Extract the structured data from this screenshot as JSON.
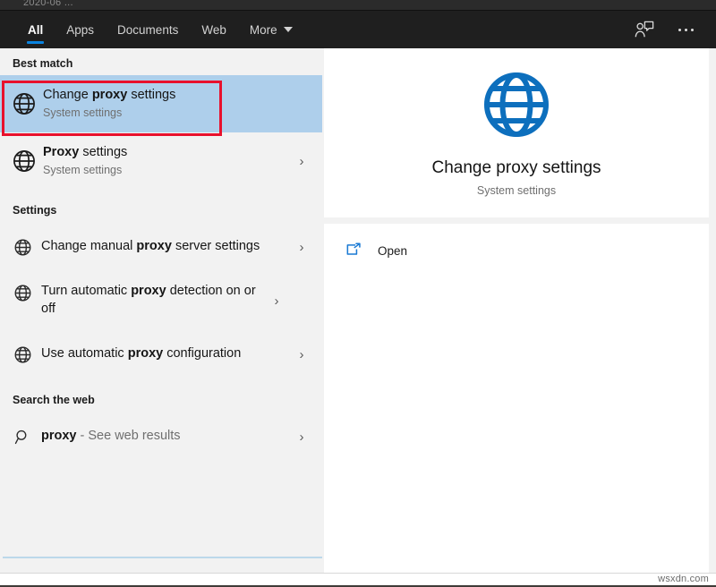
{
  "window": {
    "partial_top_text": "2020-06 ...",
    "watermark": "wsxdn.com"
  },
  "tabs": {
    "items": [
      {
        "label": "All",
        "active": true
      },
      {
        "label": "Apps",
        "active": false
      },
      {
        "label": "Documents",
        "active": false
      },
      {
        "label": "Web",
        "active": false
      },
      {
        "label": "More",
        "active": false,
        "has_caret": true
      }
    ],
    "actions": [
      {
        "name": "feedback-icon",
        "label": "Feedback"
      },
      {
        "name": "more-options-icon",
        "label": "See more"
      }
    ],
    "accent_color": "#0a84e0",
    "bar_color": "#1f1f1f"
  },
  "results": {
    "best_match": {
      "heading": "Best match",
      "item": {
        "title_prefix": "Change ",
        "title_bold": "proxy",
        "title_suffix": " settings",
        "subtitle": "System settings",
        "icon": "globe-icon",
        "selected": true,
        "highlight_color": "#aecfeb",
        "annotation_color": "#e8112d"
      }
    },
    "second_item": {
      "title_prefix": "",
      "title_bold": "Proxy",
      "title_suffix": " settings",
      "subtitle": "System settings",
      "icon": "globe-icon"
    },
    "settings": {
      "heading": "Settings",
      "items": [
        {
          "title_prefix": "Change manual ",
          "title_bold": "proxy",
          "title_suffix": " server settings",
          "icon": "globe-icon"
        },
        {
          "title_prefix": "Turn automatic ",
          "title_bold": "proxy",
          "title_suffix": " detection on or off",
          "icon": "globe-icon"
        },
        {
          "title_prefix": "Use automatic ",
          "title_bold": "proxy",
          "title_suffix": " configuration",
          "icon": "globe-icon"
        }
      ]
    },
    "search_web": {
      "heading": "Search the web",
      "item": {
        "query": "proxy",
        "suffix": " - See web results",
        "icon": "search-icon"
      }
    }
  },
  "preview": {
    "icon": "globe-icon-large",
    "icon_color": "#0d6fbd",
    "title": "Change proxy settings",
    "subtitle": "System settings",
    "actions": [
      {
        "label": "Open",
        "icon": "open-external-icon",
        "icon_color": "#1a7ad4"
      }
    ]
  }
}
